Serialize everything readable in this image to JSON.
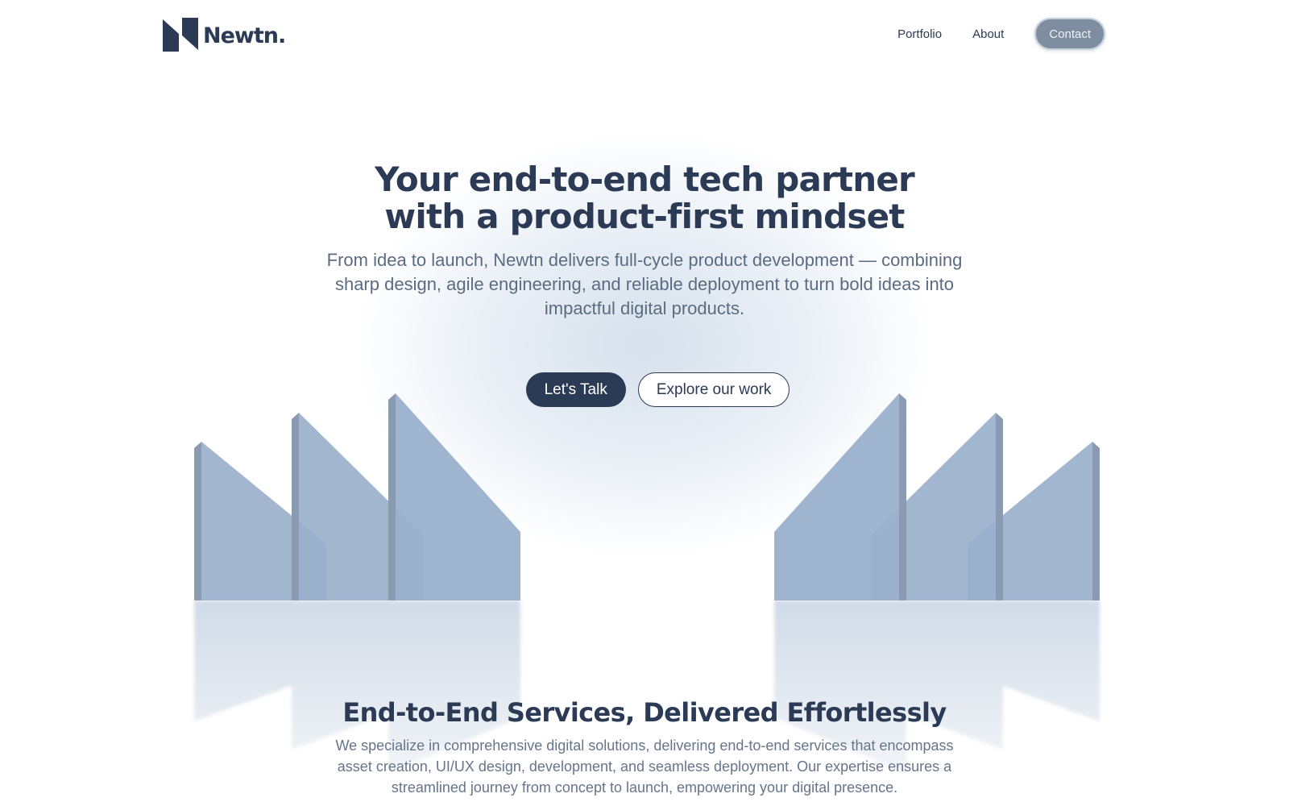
{
  "header": {
    "logo_text": "Newtn.",
    "nav": {
      "portfolio": "Portfolio",
      "about": "About",
      "contact": "Contact"
    }
  },
  "hero": {
    "title": "Your end-to-end tech partner with a product-first mindset",
    "subtitle": "From idea to launch, Newtn delivers full-cycle product development — combining sharp design, agile engineering, and reliable deployment to turn bold ideas into impactful digital products.",
    "primary_cta": "Let's Talk",
    "secondary_cta": "Explore our work"
  },
  "services": {
    "title": "End-to-End Services, Delivered Effortlessly",
    "description": "We specialize in comprehensive digital solutions, delivering end-to-end services that encompass asset creation, UI/UX design, development, and seamless deployment. Our expertise ensures a streamlined journey from concept to launch, empowering your digital presence."
  },
  "colors": {
    "brand_navy": "#2b3a55",
    "panel_blue": "#9ab0cc",
    "contact_bg": "#7f8da1",
    "glow": "#d6e1ec"
  },
  "icons": {
    "logo_mark": "newtn-logo-mark-icon"
  }
}
